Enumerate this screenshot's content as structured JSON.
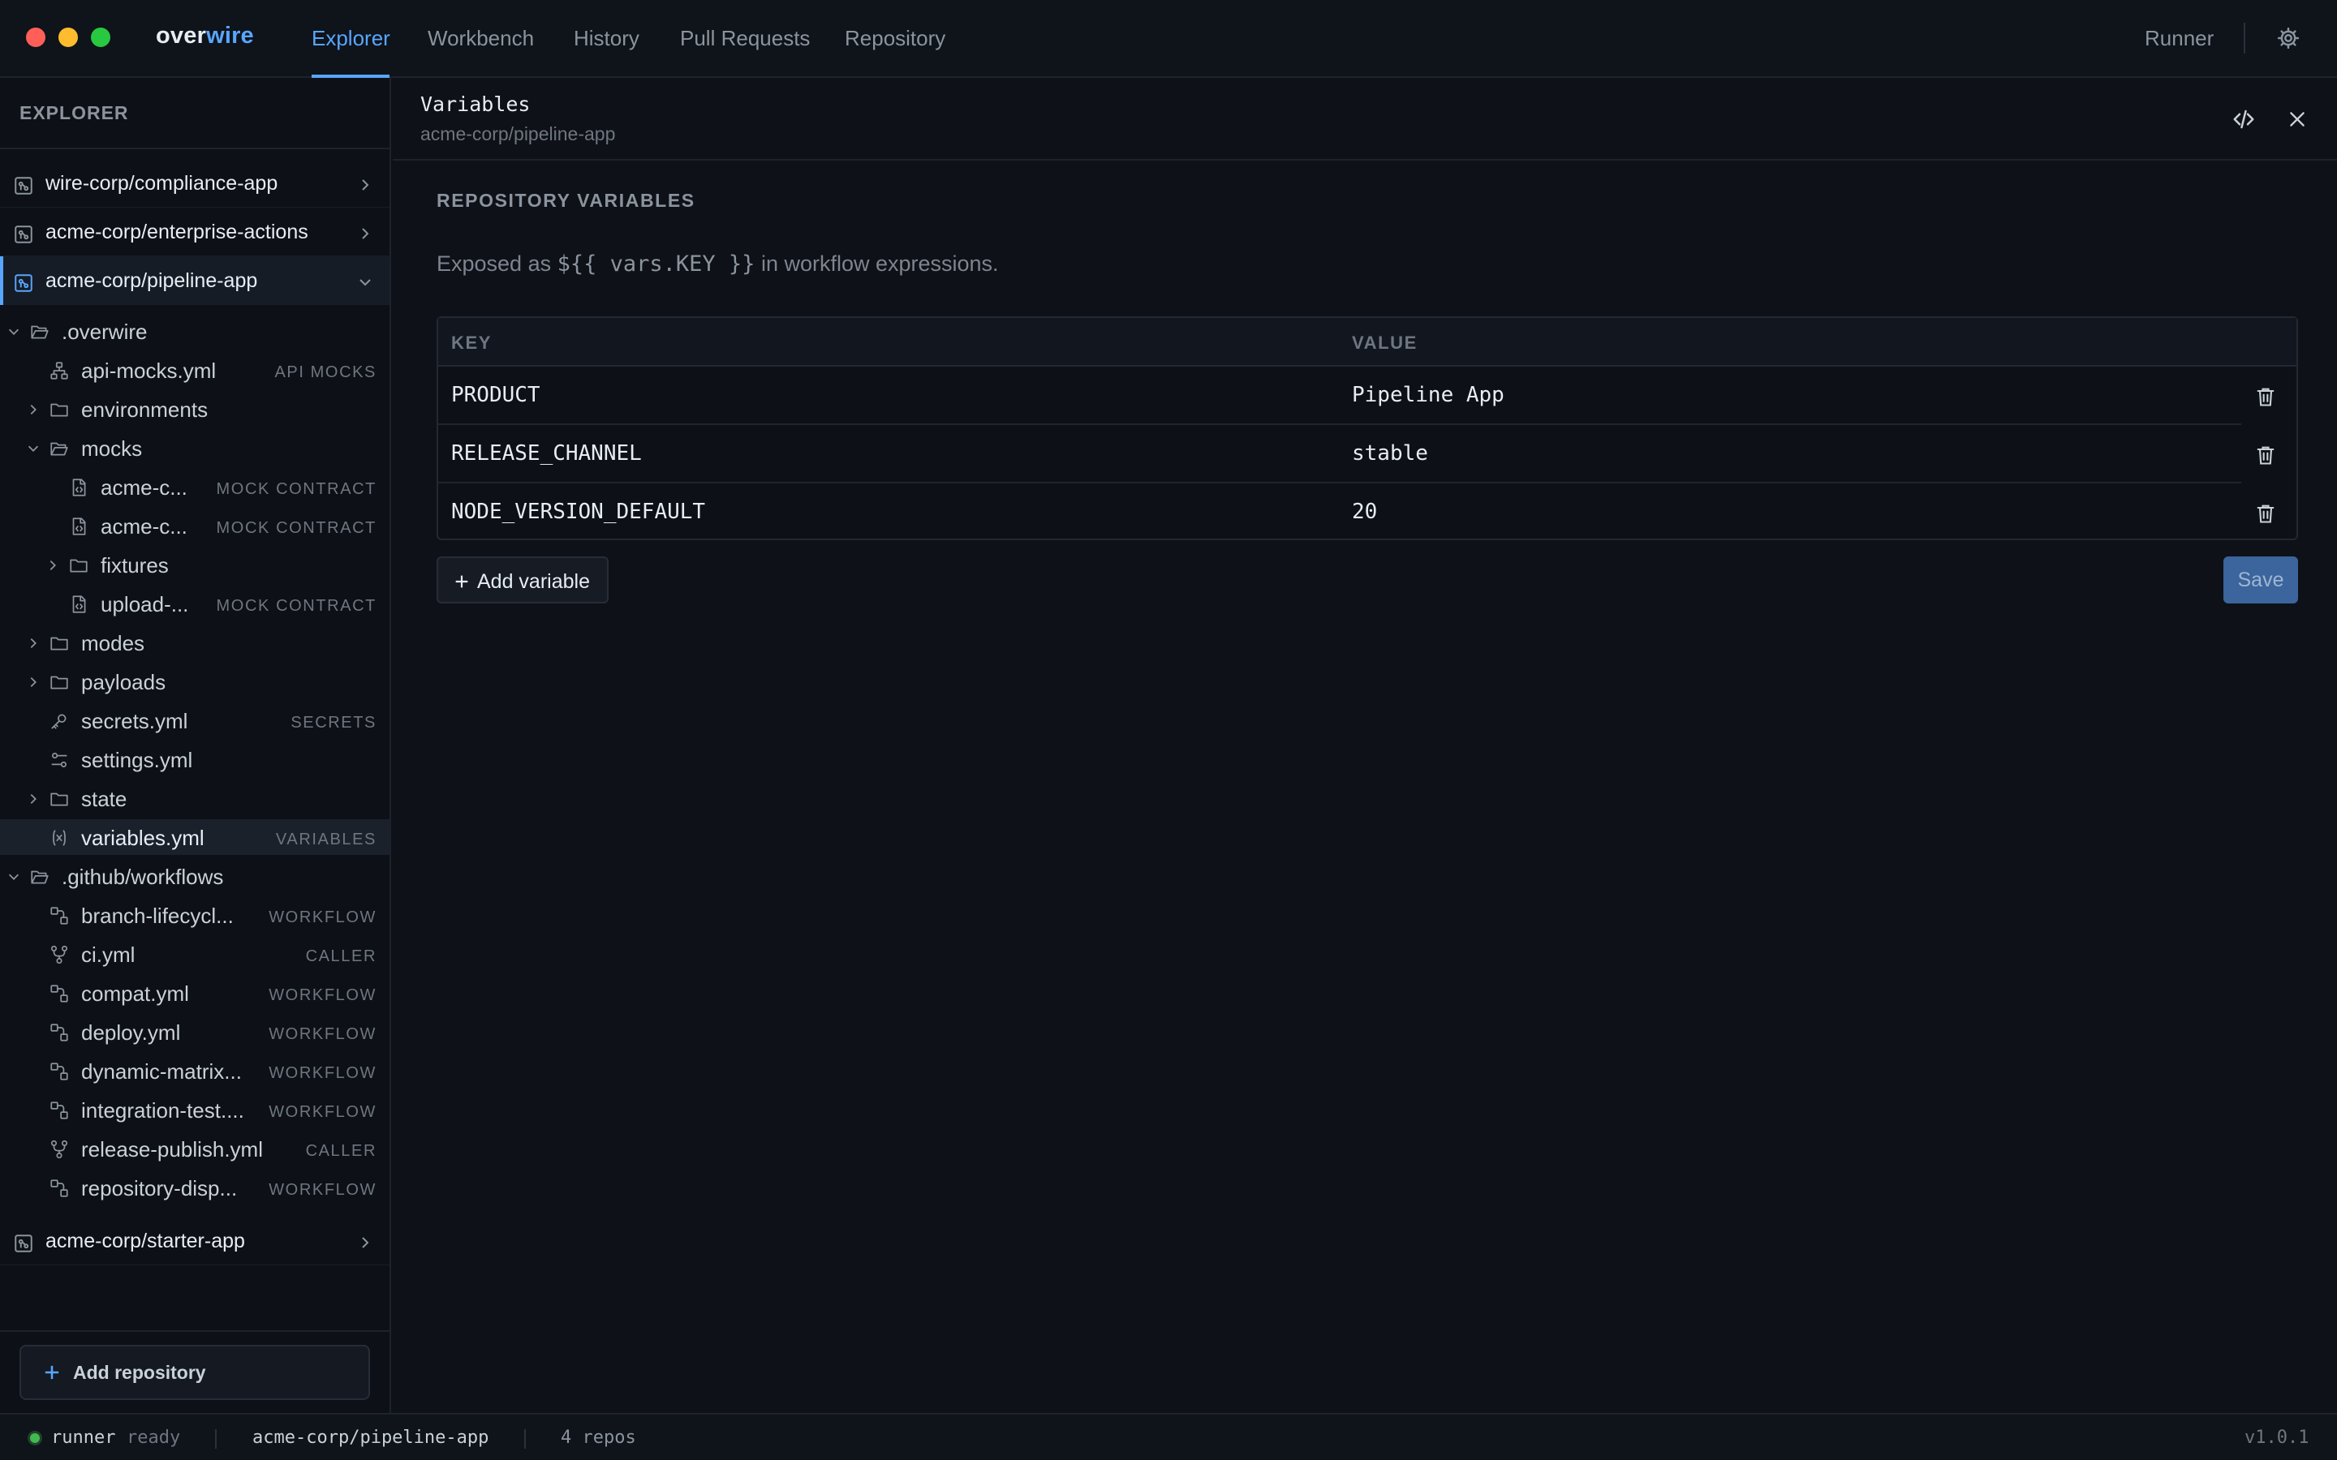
{
  "app": {
    "logo_primary": "over",
    "logo_accent": "wire"
  },
  "nav": {
    "tabs": [
      "Explorer",
      "Workbench",
      "History",
      "Pull Requests",
      "Repository"
    ],
    "active_tab": "Explorer",
    "runner_label": "Runner"
  },
  "sidebar": {
    "title": "EXPLORER",
    "repos": [
      {
        "name": "wire-corp/compliance-app",
        "expanded": false
      },
      {
        "name": "acme-corp/enterprise-actions",
        "expanded": false
      },
      {
        "name": "acme-corp/pipeline-app",
        "expanded": true,
        "active": true
      },
      {
        "name": "acme-corp/starter-app",
        "expanded": false
      }
    ],
    "tree": [
      {
        "name": ".overwire",
        "badge": "",
        "icon": "folder-open-icon",
        "kind": "folder-open"
      },
      {
        "name": "api-mocks.yml",
        "badge": "API MOCKS",
        "icon": "api-mocks-icon",
        "kind": "file"
      },
      {
        "name": "environments",
        "badge": "",
        "icon": "folder-icon",
        "kind": "folder"
      },
      {
        "name": "mocks",
        "badge": "",
        "icon": "folder-open-icon",
        "kind": "folder-open"
      },
      {
        "name": "acme-c...",
        "badge": "MOCK CONTRACT",
        "icon": "mock-contract-icon",
        "kind": "file"
      },
      {
        "name": "acme-c...",
        "badge": "MOCK CONTRACT",
        "icon": "mock-contract-icon",
        "kind": "file"
      },
      {
        "name": "fixtures",
        "badge": "",
        "icon": "folder-icon",
        "kind": "folder"
      },
      {
        "name": "upload-...",
        "badge": "MOCK CONTRACT",
        "icon": "mock-contract-icon",
        "kind": "file"
      },
      {
        "name": "modes",
        "badge": "",
        "icon": "folder-icon",
        "kind": "folder"
      },
      {
        "name": "payloads",
        "badge": "",
        "icon": "folder-icon",
        "kind": "folder"
      },
      {
        "name": "secrets.yml",
        "badge": "SECRETS",
        "icon": "key-icon",
        "kind": "file"
      },
      {
        "name": "settings.yml",
        "badge": "",
        "icon": "settings-file-icon",
        "kind": "file"
      },
      {
        "name": "state",
        "badge": "",
        "icon": "folder-icon",
        "kind": "folder"
      },
      {
        "name": "variables.yml",
        "badge": "VARIABLES",
        "icon": "variable-icon",
        "kind": "file",
        "selected": true
      },
      {
        "name": ".github/workflows",
        "badge": "",
        "icon": "folder-open-icon",
        "kind": "folder-open"
      },
      {
        "name": "branch-lifecycl...",
        "badge": "WORKFLOW",
        "icon": "workflow-icon",
        "kind": "file"
      },
      {
        "name": "ci.yml",
        "badge": "CALLER",
        "icon": "caller-icon",
        "kind": "file"
      },
      {
        "name": "compat.yml",
        "badge": "WORKFLOW",
        "icon": "workflow-icon",
        "kind": "file"
      },
      {
        "name": "deploy.yml",
        "badge": "WORKFLOW",
        "icon": "workflow-icon",
        "kind": "file"
      },
      {
        "name": "dynamic-matrix...",
        "badge": "WORKFLOW",
        "icon": "workflow-icon",
        "kind": "file"
      },
      {
        "name": "integration-test....",
        "badge": "WORKFLOW",
        "icon": "workflow-icon",
        "kind": "file"
      },
      {
        "name": "release-publish.yml",
        "badge": "CALLER",
        "icon": "caller-icon",
        "kind": "file"
      },
      {
        "name": "repository-disp...",
        "badge": "WORKFLOW",
        "icon": "workflow-icon",
        "kind": "file"
      }
    ],
    "add_repo_label": "Add repository"
  },
  "panel": {
    "title": "Variables",
    "subtitle": "acme-corp/pipeline-app",
    "section_title": "REPOSITORY VARIABLES",
    "hint_prefix": "Exposed as ",
    "hint_code": "${{ vars.KEY }}",
    "hint_suffix": " in workflow expressions.",
    "columns": [
      "KEY",
      "VALUE"
    ],
    "variables": [
      {
        "key": "PRODUCT",
        "value": "Pipeline App"
      },
      {
        "key": "RELEASE_CHANNEL",
        "value": "stable"
      },
      {
        "key": "NODE_VERSION_DEFAULT",
        "value": "20"
      }
    ],
    "add_variable_label": "Add variable",
    "save_label": "Save"
  },
  "status": {
    "runner": "runner",
    "runner_state": "ready",
    "repo": "acme-corp/pipeline-app",
    "repo_count": "4 repos",
    "version": "v1.0.1"
  },
  "colors": {
    "accent": "#58a6ff",
    "background": "#0e1117",
    "save_button": "#3b659c",
    "status_ok": "#3fb950"
  }
}
